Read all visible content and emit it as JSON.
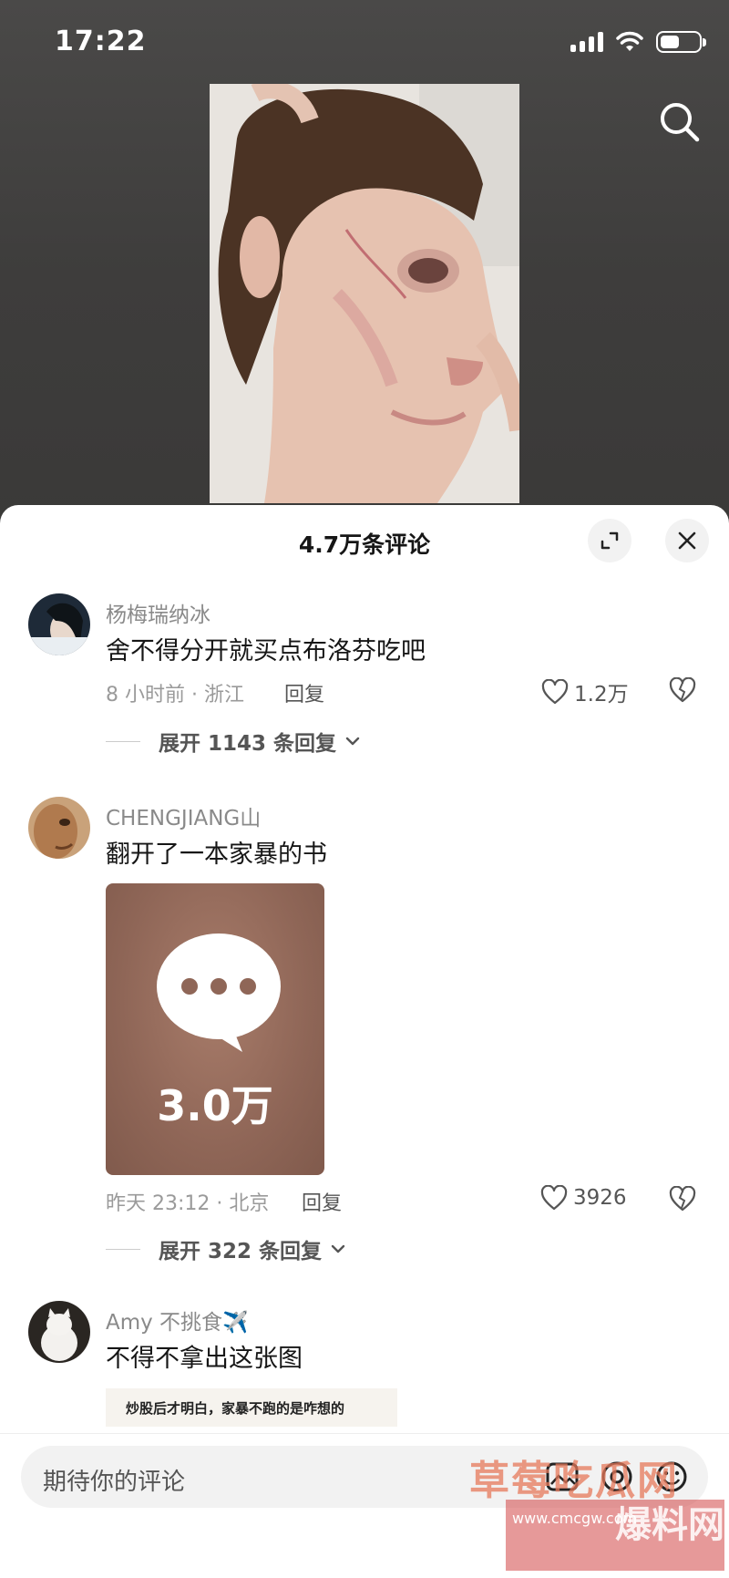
{
  "status_bar": {
    "time": "17:22"
  },
  "sheet": {
    "title": "4.7万条评论"
  },
  "comments": [
    {
      "username": "杨梅瑞纳冰",
      "text": "舍不得分开就买点布洛芬吃吧",
      "meta": "8 小时前 · 浙江",
      "reply_label": "回复",
      "likes": "1.2万",
      "expand_label": "展开 1143 条回复"
    },
    {
      "username": "CHENGJIANG山",
      "text": "翻开了一本家暴的书",
      "sticker_count": "3.0万",
      "meta": "昨天 23:12 · 北京",
      "reply_label": "回复",
      "likes": "3926",
      "expand_label": "展开 322 条回复"
    },
    {
      "username": "Amy 不挑食✈️",
      "text": "不得不拿出这张图",
      "image_caption": "炒股后才明白，家暴不跑的是咋想的"
    }
  ],
  "input": {
    "placeholder": "期待你的评论"
  },
  "watermark": {
    "text": "草莓吃瓜网",
    "url": "www.cmcgw.com",
    "big": "爆料网"
  },
  "colors": {
    "sheet_bg": "#ffffff",
    "video_bg": "#3a3938",
    "text_primary": "#161616",
    "text_secondary": "#8a8a8a"
  }
}
